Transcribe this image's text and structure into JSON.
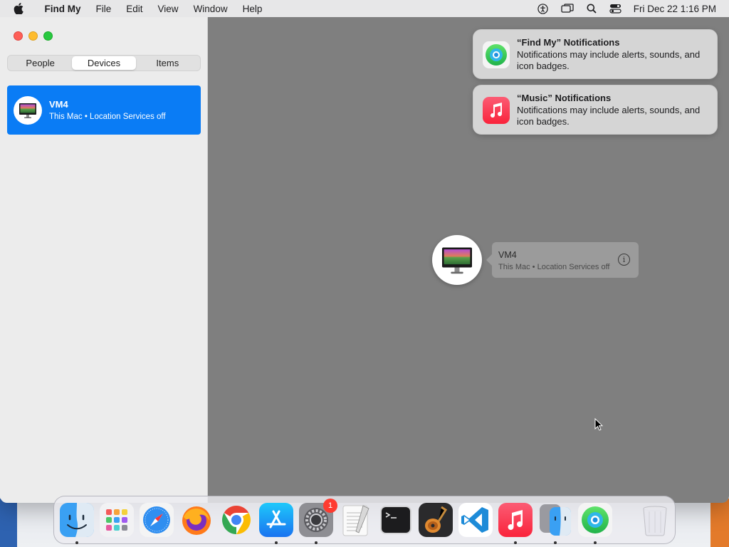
{
  "menubar": {
    "app_name": "Find My",
    "menus": [
      "File",
      "Edit",
      "View",
      "Window",
      "Help"
    ],
    "status_icons": [
      "accessibility-icon",
      "screen-mirroring-icon",
      "spotlight-icon",
      "control-center-icon"
    ],
    "clock": "Fri Dec 22  1:16 PM"
  },
  "sidebar": {
    "tabs": [
      {
        "label": "People",
        "active": false
      },
      {
        "label": "Devices",
        "active": true
      },
      {
        "label": "Items",
        "active": false
      }
    ],
    "devices": [
      {
        "name": "VM4",
        "subtitle": "This Mac • Location Services off",
        "selected": true
      }
    ]
  },
  "map": {
    "callout": {
      "name": "VM4",
      "subtitle": "This Mac • Location Services off",
      "info_glyph": "i"
    }
  },
  "notifications": [
    {
      "title": "“Find My” Notifications",
      "body": "Notifications may include alerts, sounds, and icon badges.",
      "icon": "find-my-icon"
    },
    {
      "title": "“Music” Notifications",
      "body": "Notifications may include alerts, sounds, and icon badges.",
      "icon": "music-icon"
    }
  ],
  "dock": {
    "apps": [
      {
        "name": "finder",
        "running": true
      },
      {
        "name": "launchpad",
        "running": false
      },
      {
        "name": "safari",
        "running": false
      },
      {
        "name": "firefox",
        "running": false
      },
      {
        "name": "chrome",
        "running": false
      },
      {
        "name": "app-store",
        "running": true
      },
      {
        "name": "system-settings",
        "running": true,
        "badge": "1"
      },
      {
        "name": "textedit",
        "running": false
      },
      {
        "name": "terminal",
        "running": false
      },
      {
        "name": "garageband",
        "running": false
      },
      {
        "name": "vscode",
        "running": false
      },
      {
        "name": "music",
        "running": true
      },
      {
        "name": "migration-assistant",
        "running": true
      },
      {
        "name": "find-my",
        "running": true
      }
    ],
    "trash": "trash"
  },
  "colors": {
    "accent": "#0a7cf5",
    "map_bg": "#7f7f7f",
    "badge": "#fe3b30"
  }
}
